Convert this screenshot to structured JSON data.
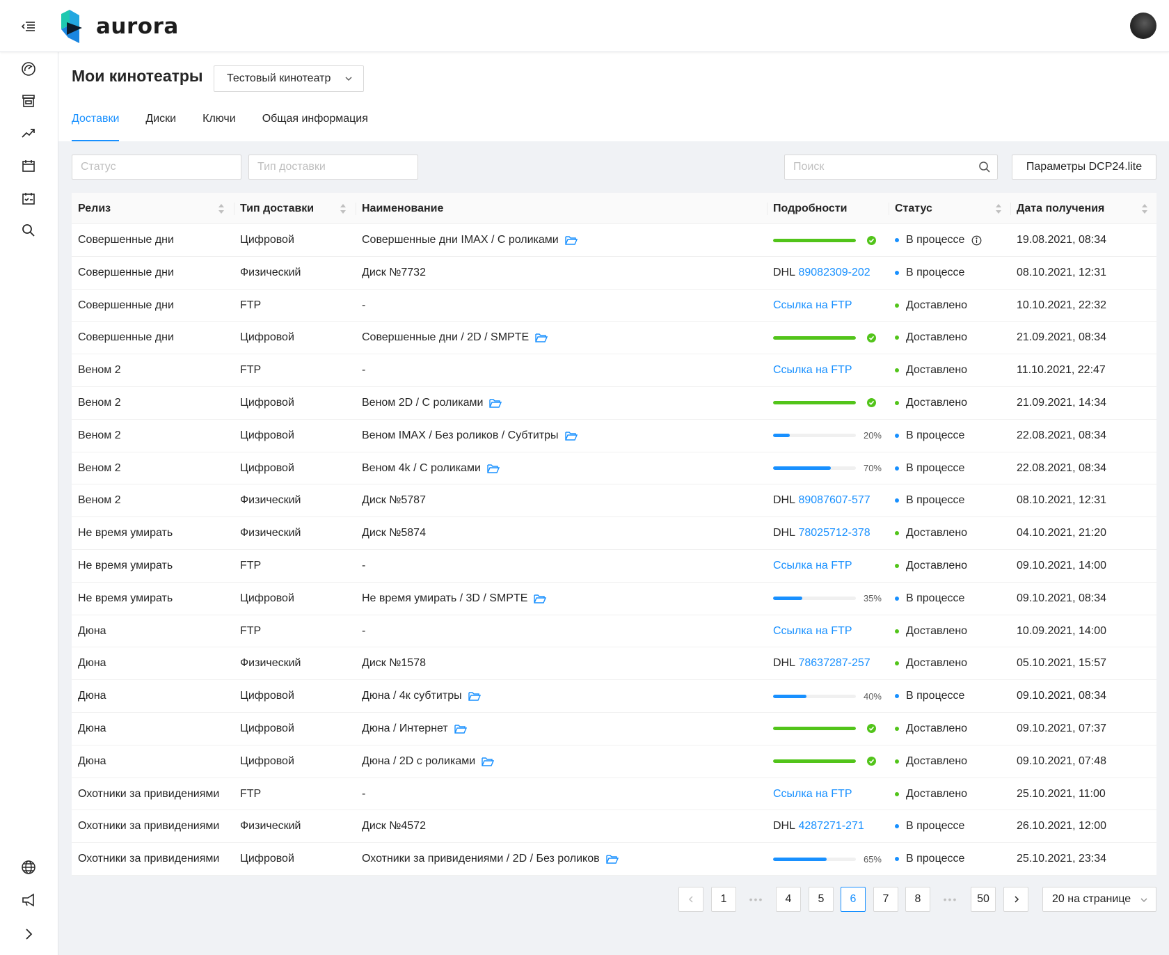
{
  "brand": {
    "name": "aurora"
  },
  "header": {
    "title": "Мои кинотеатры",
    "cinema": "Тестовый кинотеатр"
  },
  "tabs": [
    {
      "label": "Доставки",
      "active": true
    },
    {
      "label": "Диски",
      "active": false
    },
    {
      "label": "Ключи",
      "active": false
    },
    {
      "label": "Общая информация",
      "active": false
    }
  ],
  "filters": {
    "status_placeholder": "Статус",
    "delivery_type_placeholder": "Тип доставки",
    "search_placeholder": "Поиск",
    "params_button": "Параметры DCP24.lite"
  },
  "columns": {
    "release": "Релиз",
    "delivery_type": "Тип доставки",
    "name": "Наименование",
    "details": "Подробности",
    "status": "Статус",
    "received": "Дата получения"
  },
  "colors": {
    "accent": "#1890ff",
    "success": "#52c41a",
    "in_progress": "#1890ff"
  },
  "rows": [
    {
      "release": "Совершенные дни",
      "type": "Цифровой",
      "name": "Совершенные дни IMAX / С роликами",
      "folder": true,
      "detail": {
        "kind": "progress",
        "percent": 100
      },
      "status": "В процессе",
      "status_kind": "progress",
      "status_info": true,
      "date": "19.08.2021, 08:34"
    },
    {
      "release": "Совершенные дни",
      "type": "Физический",
      "name": "Диск №7732",
      "folder": false,
      "detail": {
        "kind": "dhl",
        "prefix": "DHL",
        "tracking": "89082309-202"
      },
      "status": "В процессе",
      "status_kind": "progress",
      "date": "08.10.2021, 12:31"
    },
    {
      "release": "Совершенные дни",
      "type": "FTP",
      "name": "-",
      "folder": false,
      "detail": {
        "kind": "ftp",
        "text": "Ссылка на FTP"
      },
      "status": "Доставлено",
      "status_kind": "done",
      "date": "10.10.2021, 22:32"
    },
    {
      "release": "Совершенные дни",
      "type": "Цифровой",
      "name": "Совершенные дни / 2D / SMPTE",
      "folder": true,
      "detail": {
        "kind": "progress",
        "percent": 100
      },
      "status": "Доставлено",
      "status_kind": "done",
      "date": "21.09.2021, 08:34"
    },
    {
      "release": "Веном 2",
      "type": "FTP",
      "name": "-",
      "folder": false,
      "detail": {
        "kind": "ftp",
        "text": "Ссылка на FTP"
      },
      "status": "Доставлено",
      "status_kind": "done",
      "date": "11.10.2021, 22:47"
    },
    {
      "release": "Веном 2",
      "type": "Цифровой",
      "name": "Веном 2D / С роликами",
      "folder": true,
      "detail": {
        "kind": "progress",
        "percent": 100
      },
      "status": "Доставлено",
      "status_kind": "done",
      "date": "21.09.2021, 14:34"
    },
    {
      "release": "Веном 2",
      "type": "Цифровой",
      "name": "Веном IMAX / Без роликов / Субтитры",
      "folder": true,
      "detail": {
        "kind": "progress",
        "percent": 20,
        "label": "20%"
      },
      "status": "В процессе",
      "status_kind": "progress",
      "date": "22.08.2021, 08:34"
    },
    {
      "release": "Веном 2",
      "type": "Цифровой",
      "name": "Веном 4k / С роликами",
      "folder": true,
      "detail": {
        "kind": "progress",
        "percent": 70,
        "label": "70%"
      },
      "status": "В процессе",
      "status_kind": "progress",
      "date": "22.08.2021, 08:34"
    },
    {
      "release": "Веном 2",
      "type": "Физический",
      "name": "Диск №5787",
      "folder": false,
      "detail": {
        "kind": "dhl",
        "prefix": "DHL",
        "tracking": "89087607-577"
      },
      "status": "В процессе",
      "status_kind": "progress",
      "date": "08.10.2021, 12:31"
    },
    {
      "release": "Не время умирать",
      "type": "Физический",
      "name": "Диск №5874",
      "folder": false,
      "detail": {
        "kind": "dhl",
        "prefix": "DHL",
        "tracking": "78025712-378"
      },
      "status": "Доставлено",
      "status_kind": "done",
      "date": "04.10.2021, 21:20"
    },
    {
      "release": "Не время умирать",
      "type": "FTP",
      "name": "-",
      "folder": false,
      "detail": {
        "kind": "ftp",
        "text": "Ссылка на FTP"
      },
      "status": "Доставлено",
      "status_kind": "done",
      "date": "09.10.2021, 14:00"
    },
    {
      "release": "Не время умирать",
      "type": "Цифровой",
      "name": "Не время умирать / 3D / SMPTE",
      "folder": true,
      "detail": {
        "kind": "progress",
        "percent": 35,
        "label": "35%"
      },
      "status": "В процессе",
      "status_kind": "progress",
      "date": "09.10.2021, 08:34"
    },
    {
      "release": "Дюна",
      "type": "FTP",
      "name": "-",
      "folder": false,
      "detail": {
        "kind": "ftp",
        "text": "Ссылка на FTP"
      },
      "status": "Доставлено",
      "status_kind": "done",
      "date": "10.09.2021, 14:00"
    },
    {
      "release": "Дюна",
      "type": "Физический",
      "name": "Диск №1578",
      "folder": false,
      "detail": {
        "kind": "dhl",
        "prefix": "DHL",
        "tracking": "78637287-257"
      },
      "status": "Доставлено",
      "status_kind": "done",
      "date": "05.10.2021, 15:57"
    },
    {
      "release": "Дюна",
      "type": "Цифровой",
      "name": "Дюна / 4к субтитры",
      "folder": true,
      "detail": {
        "kind": "progress",
        "percent": 40,
        "label": "40%"
      },
      "status": "В процессе",
      "status_kind": "progress",
      "date": "09.10.2021, 08:34"
    },
    {
      "release": "Дюна",
      "type": "Цифровой",
      "name": "Дюна / Интернет",
      "folder": true,
      "detail": {
        "kind": "progress",
        "percent": 100
      },
      "status": "Доставлено",
      "status_kind": "done",
      "date": "09.10.2021, 07:37"
    },
    {
      "release": "Дюна",
      "type": "Цифровой",
      "name": "Дюна / 2D с роликами",
      "folder": true,
      "detail": {
        "kind": "progress",
        "percent": 100
      },
      "status": "Доставлено",
      "status_kind": "done",
      "date": "09.10.2021, 07:48"
    },
    {
      "release": "Охотники за привидениями",
      "type": "FTP",
      "name": "-",
      "folder": false,
      "detail": {
        "kind": "ftp",
        "text": "Ссылка на FTP"
      },
      "status": "Доставлено",
      "status_kind": "done",
      "date": "25.10.2021, 11:00"
    },
    {
      "release": "Охотники за привидениями",
      "type": "Физический",
      "name": "Диск №4572",
      "folder": false,
      "detail": {
        "kind": "dhl",
        "prefix": "DHL",
        "tracking": "4287271-271"
      },
      "status": "В процессе",
      "status_kind": "progress",
      "date": "26.10.2021, 12:00"
    },
    {
      "release": "Охотники за привидениями",
      "type": "Цифровой",
      "name": "Охотники за привидениями / 2D / Без роликов",
      "folder": true,
      "detail": {
        "kind": "progress",
        "percent": 65,
        "label": "65%"
      },
      "status": "В процессе",
      "status_kind": "progress",
      "date": "25.10.2021, 23:34"
    }
  ],
  "pagination": {
    "prev_icon": "chevron-left-icon",
    "next_icon": "chevron-right-icon",
    "items": [
      "1",
      "•••",
      "4",
      "5",
      "6",
      "7",
      "8",
      "•••",
      "50"
    ],
    "current": "6",
    "per_page": "20 на странице"
  },
  "sidebar": {
    "icons": [
      "dashboard-icon",
      "shop-icon",
      "trend-icon",
      "calendar-icon",
      "schedule-icon",
      "search-icon",
      "globe-icon",
      "megaphone-icon",
      "chevron-right-icon"
    ]
  }
}
